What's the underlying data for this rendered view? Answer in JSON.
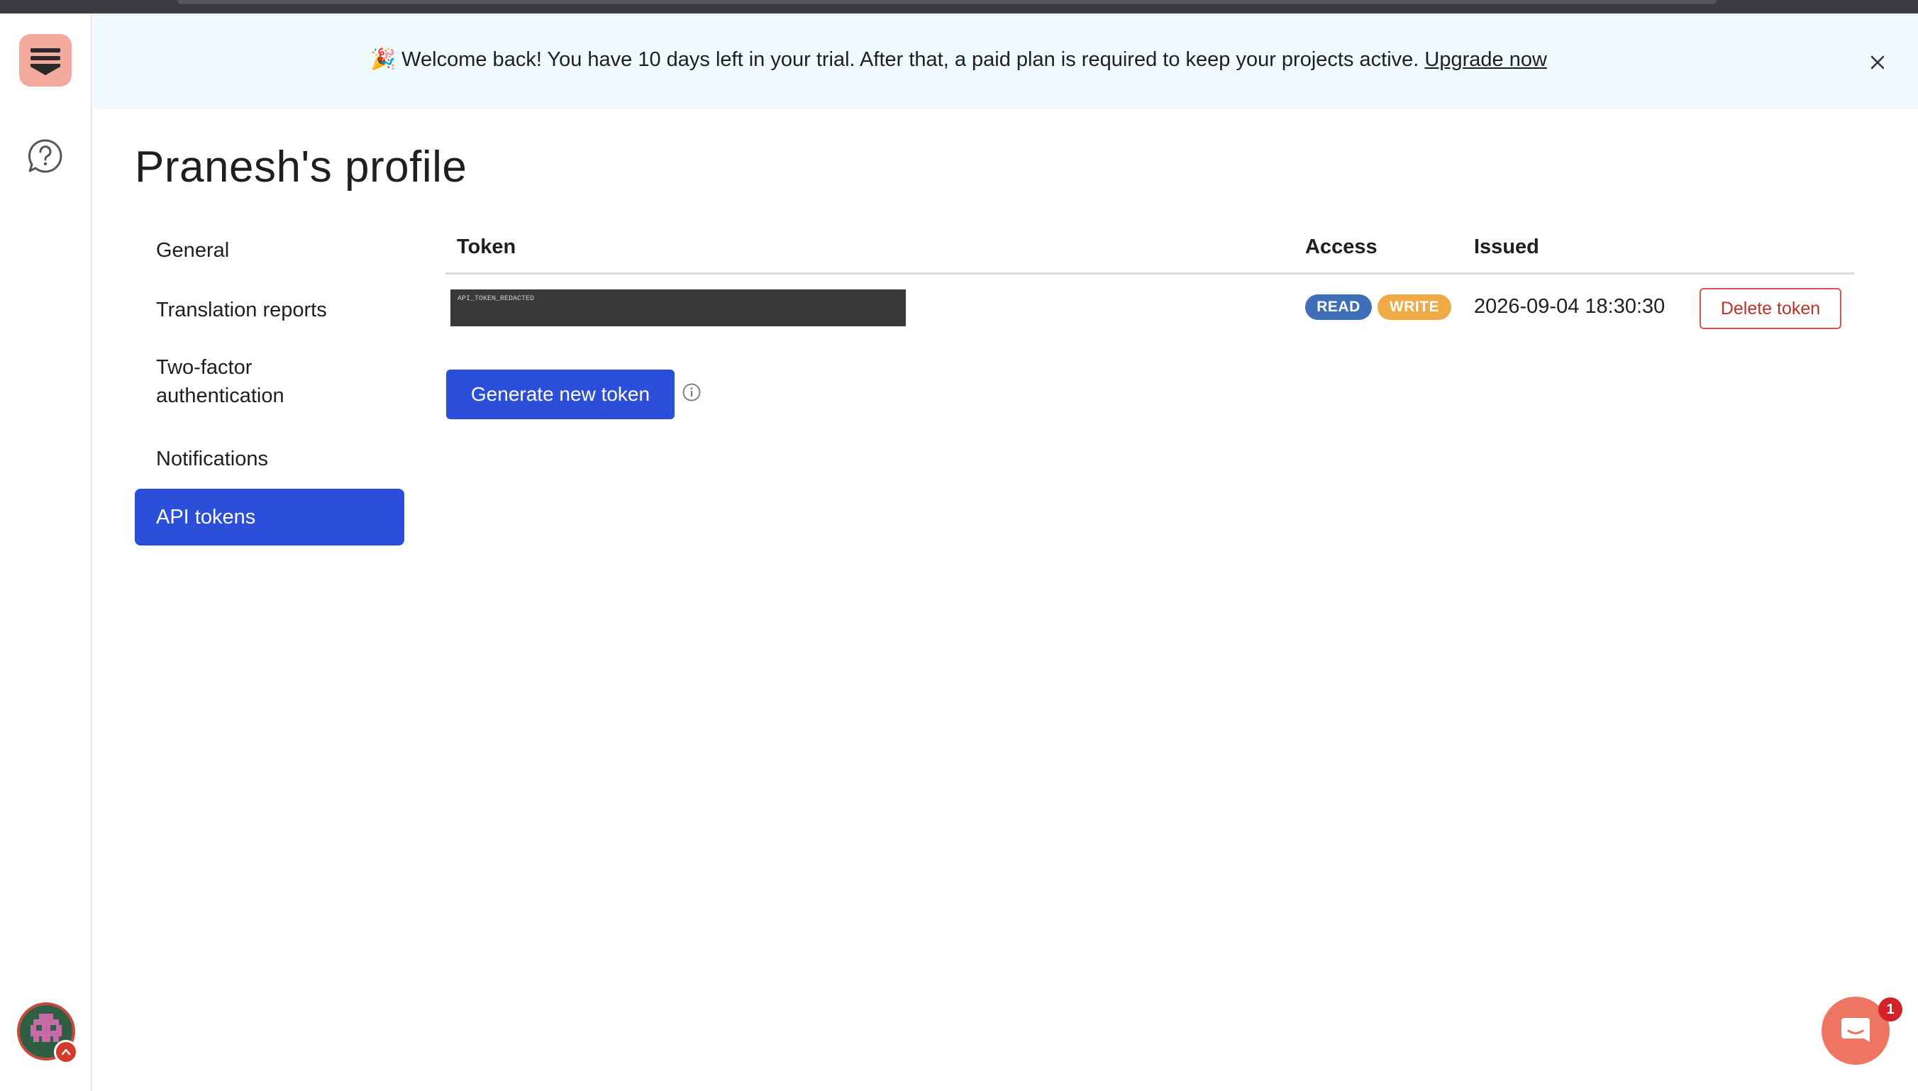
{
  "banner": {
    "emoji": "🎉",
    "message": "Welcome back! You have 10 days left in your trial. After that, a paid plan is required to keep your projects active.",
    "link_label": "Upgrade now"
  },
  "page": {
    "title": "Pranesh's profile"
  },
  "nav": {
    "items": [
      {
        "label": "General"
      },
      {
        "label": "Translation reports"
      },
      {
        "label": "Two-factor authentication",
        "line1": "Two-factor",
        "line2": "authentication"
      },
      {
        "label": "Notifications"
      },
      {
        "label": "API tokens",
        "active": true
      }
    ]
  },
  "table": {
    "headers": {
      "token": "Token",
      "access": "Access",
      "issued": "Issued"
    },
    "rows": [
      {
        "token": "API_TOKEN_REDACTED",
        "access": [
          "READ",
          "WRITE"
        ],
        "issued": "2026-09-04 18:30:30",
        "action_label": "Delete token"
      }
    ]
  },
  "actions": {
    "generate_label": "Generate new token"
  },
  "chat": {
    "badge_count": "1"
  },
  "colors": {
    "primary": "#2b4fd8",
    "banner_bg": "#eefafd",
    "read_badge": "#3e6fb8",
    "write_badge": "#efaa45",
    "danger": "#d9534f",
    "logo_bg": "#f4a99d",
    "chat_bg": "#ef7563"
  },
  "icons": {
    "logo": "stacked-bars-logo-icon",
    "help": "question-circle-icon",
    "close": "close-icon",
    "info": "info-circle-icon",
    "chat": "chat-bubble-icon",
    "avatar": "pixel-invader-avatar"
  }
}
